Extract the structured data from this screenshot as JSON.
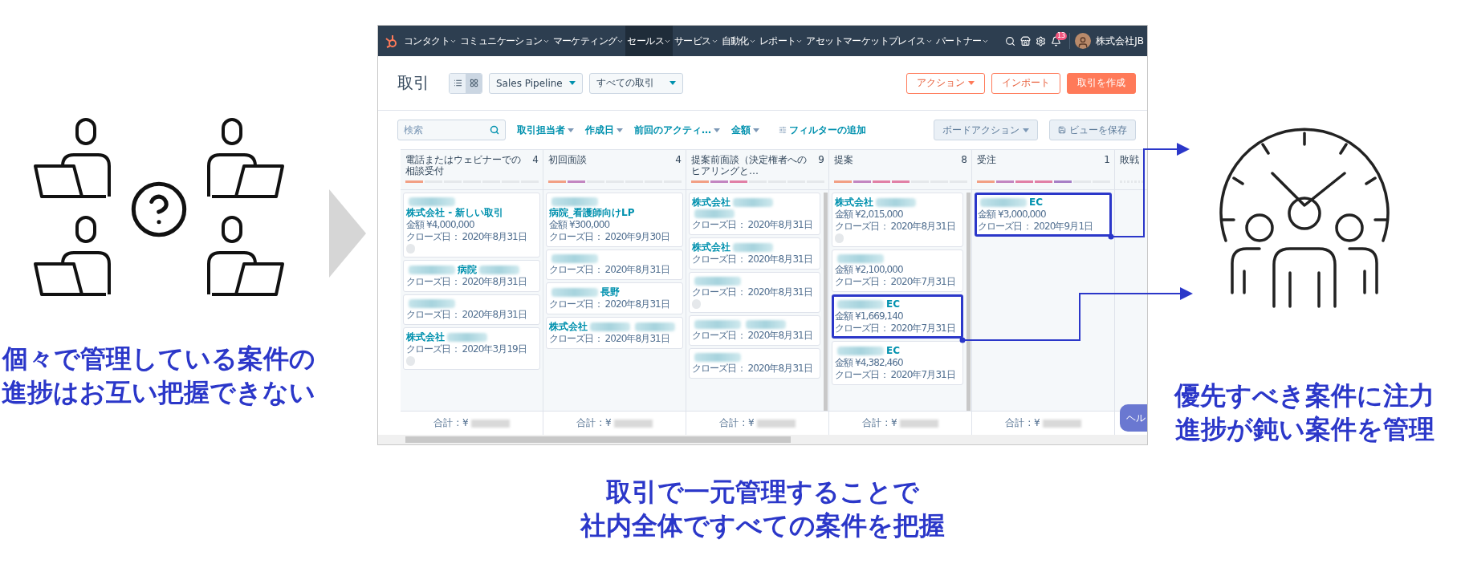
{
  "left": {
    "caption": [
      "個々で管理している案件の",
      "進捗はお互い把握できない"
    ]
  },
  "app": {
    "nav": {
      "items": [
        {
          "label": "コンタクト",
          "selected": false
        },
        {
          "label": "コミュニケーション",
          "selected": false
        },
        {
          "label": "マーケティング",
          "selected": false
        },
        {
          "label": "セールス",
          "selected": true
        },
        {
          "label": "サービス",
          "selected": false
        },
        {
          "label": "自動化",
          "selected": false
        },
        {
          "label": "レポート",
          "selected": false
        },
        {
          "label": "アセットマーケットプレイス",
          "selected": false
        },
        {
          "label": "パートナー",
          "selected": false
        }
      ],
      "notification_count": "13",
      "account": "株式会社JB"
    },
    "header": {
      "title": "取引",
      "views": [
        {
          "kind": "list",
          "selected": false
        },
        {
          "kind": "board",
          "selected": true
        }
      ],
      "pipeline": "Sales Pipeline",
      "filter_view": "すべての取引",
      "buttons": [
        {
          "label": "アクション",
          "kind": "menu"
        },
        {
          "label": "インポート",
          "kind": "outline"
        },
        {
          "label": "取引を作成",
          "kind": "primary"
        }
      ]
    },
    "filters": {
      "search_placeholder": "検索",
      "items": [
        "取引担当者",
        "作成日",
        "前回のアクティ…",
        "金額"
      ],
      "add_filter": "フィルターの追加",
      "board_actions": "ボードアクション",
      "save_view": "ビューを保存"
    },
    "columns": [
      {
        "name": "電話またはウェビナーでの相談受付",
        "count": "4",
        "segments": [
          {
            "color": "#f2a085"
          }
        ],
        "scrollable": false,
        "total": "合計 : ¥",
        "cards": [
          {
            "title": [
              {
                "kind": "redacted"
              },
              {
                "kind": "text",
                "text": "株式会社 - 新しい取引"
              }
            ],
            "amount": "金額 ¥4,000,000",
            "close": "クローズ日： 2020年8月31日",
            "avatar": true,
            "highlighted": false
          },
          {
            "title": [
              {
                "kind": "redacted"
              },
              {
                "kind": "text",
                "text": "病院"
              },
              {
                "kind": "redacted"
              }
            ],
            "close": "クローズ日： 2020年8月31日",
            "avatar": false,
            "highlighted": false
          },
          {
            "title": [
              {
                "kind": "redacted"
              }
            ],
            "close": "クローズ日： 2020年8月31日",
            "avatar": false,
            "highlighted": false
          },
          {
            "title": [
              {
                "kind": "text",
                "text": "株式会社"
              },
              {
                "kind": "redacted"
              }
            ],
            "close": "クローズ日： 2020年3月19日",
            "avatar": true,
            "highlighted": false
          }
        ]
      },
      {
        "name": "初回面談",
        "count": "4",
        "segments": [
          {
            "color": "#f2a085"
          },
          {
            "color": "#c386c1"
          }
        ],
        "scrollable": false,
        "total": "合計 : ¥",
        "cards": [
          {
            "title": [
              {
                "kind": "redacted"
              },
              {
                "kind": "text",
                "text": "病院_看護師向けLP"
              }
            ],
            "amount": "金額 ¥300,000",
            "close": "クローズ日： 2020年9月30日",
            "avatar": false,
            "highlighted": false
          },
          {
            "title": [
              {
                "kind": "redacted"
              }
            ],
            "close": "クローズ日： 2020年8月31日",
            "avatar": false,
            "highlighted": false
          },
          {
            "title": [
              {
                "kind": "redacted"
              },
              {
                "kind": "text",
                "text": "長野"
              }
            ],
            "close": "クローズ日： 2020年8月31日",
            "avatar": false,
            "highlighted": false
          },
          {
            "title": [
              {
                "kind": "text",
                "text": "株式会社"
              },
              {
                "kind": "redacted"
              },
              {
                "kind": "redacted"
              }
            ],
            "close": "クローズ日： 2020年8月31日",
            "avatar": false,
            "highlighted": false
          }
        ]
      },
      {
        "name": "提案前面談（決定権者へのヒアリングと…",
        "count": "9",
        "segments": [
          {
            "color": "#f2a085"
          },
          {
            "color": "#c386c1"
          },
          {
            "color": "#e180a6"
          }
        ],
        "scrollable": true,
        "total": "合計 : ¥",
        "cards": [
          {
            "title": [
              {
                "kind": "text",
                "text": "株式会社"
              },
              {
                "kind": "redacted"
              },
              {
                "kind": "redacted"
              }
            ],
            "close": "クローズ日： 2020年8月31日",
            "avatar": false,
            "highlighted": false
          },
          {
            "title": [
              {
                "kind": "text",
                "text": "株式会社"
              },
              {
                "kind": "redacted"
              }
            ],
            "close": "クローズ日： 2020年8月31日",
            "avatar": false,
            "highlighted": false
          },
          {
            "title": [
              {
                "kind": "redacted"
              }
            ],
            "close": "クローズ日： 2020年8月31日",
            "avatar": true,
            "highlighted": false
          },
          {
            "title": [
              {
                "kind": "redacted"
              },
              {
                "kind": "redacted"
              }
            ],
            "close": "クローズ日： 2020年8月31日",
            "avatar": false,
            "highlighted": false
          },
          {
            "title": [
              {
                "kind": "redacted"
              }
            ],
            "close": "クローズ日： 2020年8月31日",
            "avatar": false,
            "highlighted": false
          }
        ]
      },
      {
        "name": "提案",
        "count": "8",
        "segments": [
          {
            "color": "#f2a085"
          },
          {
            "color": "#c386c1"
          },
          {
            "color": "#e180a6"
          },
          {
            "color": "#e180a6"
          }
        ],
        "scrollable": true,
        "total": "合計 : ¥",
        "cards": [
          {
            "title": [
              {
                "kind": "text",
                "text": "株式会社"
              },
              {
                "kind": "redacted"
              }
            ],
            "amount": "金額 ¥2,015,000",
            "close": "クローズ日： 2020年8月31日",
            "avatar": true,
            "highlighted": false
          },
          {
            "title": [
              {
                "kind": "redacted"
              }
            ],
            "amount": "金額 ¥2,100,000",
            "close": "クローズ日： 2020年7月31日",
            "avatar": false,
            "highlighted": false
          },
          {
            "title": [
              {
                "kind": "redacted"
              },
              {
                "kind": "text",
                "text": "EC"
              }
            ],
            "amount": "金額 ¥1,669,140",
            "close": "クローズ日： 2020年7月31日",
            "avatar": false,
            "highlighted": true
          },
          {
            "title": [
              {
                "kind": "redacted"
              },
              {
                "kind": "text",
                "text": "EC"
              }
            ],
            "amount": "金額 ¥4,382,460",
            "close": "クローズ日： 2020年7月31日",
            "avatar": false,
            "highlighted": false
          }
        ]
      },
      {
        "name": "受注",
        "count": "1",
        "segments": [
          {
            "color": "#f2a085"
          },
          {
            "color": "#c386c1"
          },
          {
            "color": "#e180a6"
          },
          {
            "color": "#e180a6"
          },
          {
            "color": "#a77fc6"
          }
        ],
        "scrollable": false,
        "total": "合計 : ¥",
        "cards": [
          {
            "title": [
              {
                "kind": "redacted"
              },
              {
                "kind": "text",
                "text": "EC"
              }
            ],
            "amount": "金額 ¥3,000,000",
            "close": "クローズ日： 2020年9月1日",
            "avatar": false,
            "highlighted": true
          }
        ]
      },
      {
        "name": "敗戦",
        "scrollable": false
      }
    ],
    "help": "ヘル"
  },
  "center": {
    "caption": [
      "取引で一元管理することで",
      "社内全体ですべての案件を把握"
    ]
  },
  "right": {
    "caption": [
      "優先すべき案件に注力",
      "進捗が鈍い案件を管理"
    ]
  }
}
